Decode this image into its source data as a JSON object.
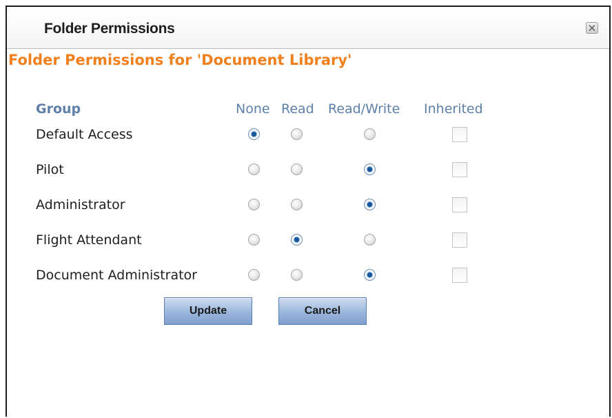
{
  "dialog": {
    "title": "Folder Permissions",
    "close_icon": "close-x-icon"
  },
  "heading": "Folder Permissions for 'Document Library'",
  "columns": {
    "group": "Group",
    "none": "None",
    "read": "Read",
    "read_write": "Read/Write",
    "inherited": "Inherited"
  },
  "rows": [
    {
      "group": "Default Access",
      "permission": "None",
      "inherited": false
    },
    {
      "group": "Pilot",
      "permission": "Read/Write",
      "inherited": false
    },
    {
      "group": "Administrator",
      "permission": "Read/Write",
      "inherited": false
    },
    {
      "group": "Flight Attendant",
      "permission": "Read",
      "inherited": false
    },
    {
      "group": "Document Administrator",
      "permission": "Read/Write",
      "inherited": false
    }
  ],
  "buttons": {
    "update": "Update",
    "cancel": "Cancel"
  },
  "colors": {
    "heading": "#f07f1e",
    "column_header": "#5d7fa8",
    "button": "#9fb9de",
    "radio_selected": "#1e64ae"
  }
}
